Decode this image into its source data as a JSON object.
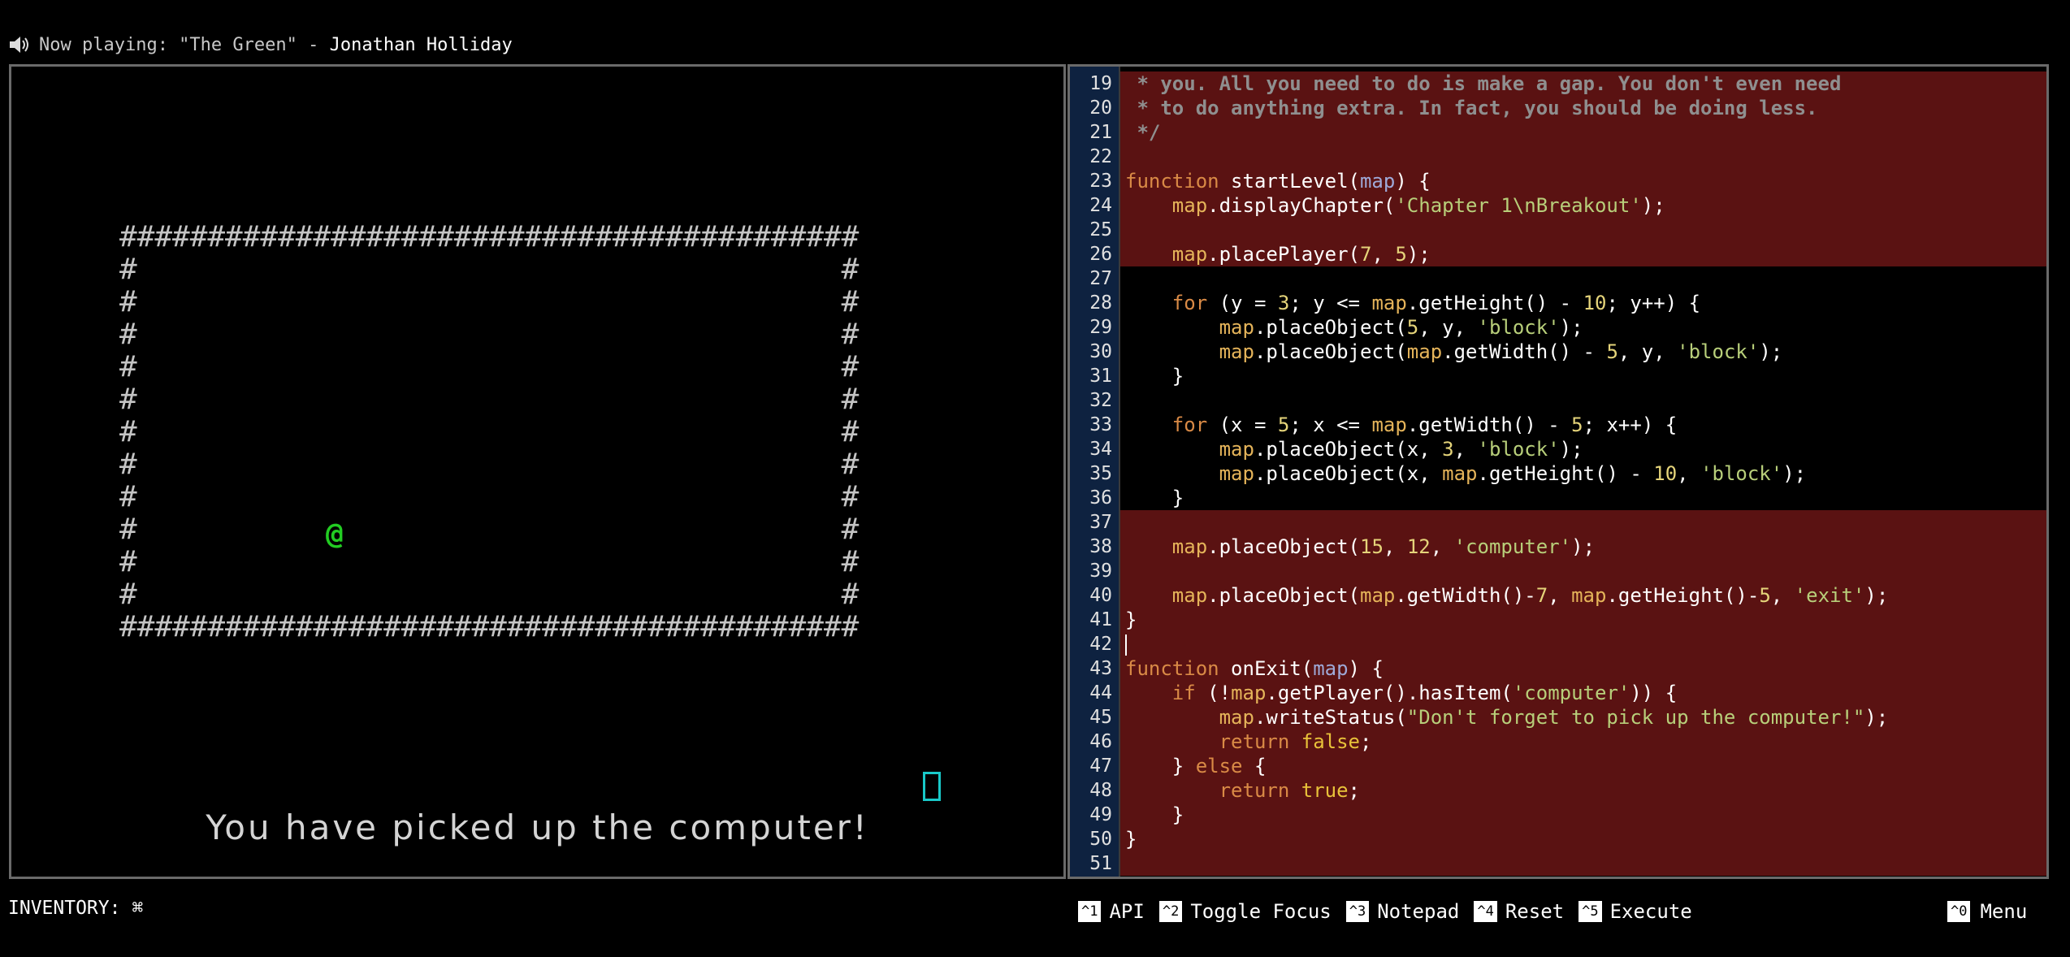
{
  "now_playing": {
    "icon": "speaker-icon",
    "label": "Now playing: \"The Green\" - ",
    "artist": "Jonathan Holliday"
  },
  "game": {
    "map_rows": [
      "##########################################",
      "#                                        #",
      "#                                        #",
      "#                                        #",
      "#                                        #",
      "#                                        #",
      "#                                        #",
      "#                                        #",
      "#                                        #",
      "#                                        #",
      "#                                        #",
      "#                                        #",
      "##########################################"
    ],
    "player_symbol": "@",
    "status": "You have picked up the computer!",
    "colors": {
      "wall": "#c4c4c4",
      "player": "#22cc22",
      "computer": "#19c9c9",
      "locked_code_bg": "#5a1212"
    }
  },
  "editor": {
    "lines": [
      {
        "n": "19",
        "locked": true,
        "tokens": [
          {
            "c": "cm",
            "t": " * you. All you need to do is make a gap. You don't even need"
          }
        ]
      },
      {
        "n": "20",
        "locked": true,
        "tokens": [
          {
            "c": "cm",
            "t": " * to do anything extra. In fact, you should be doing less."
          }
        ]
      },
      {
        "n": "21",
        "locked": true,
        "tokens": [
          {
            "c": "cm",
            "t": " */"
          }
        ]
      },
      {
        "n": "22",
        "locked": true,
        "tokens": []
      },
      {
        "n": "23",
        "locked": true,
        "tokens": [
          {
            "c": "kw",
            "t": "function"
          },
          {
            "c": "fn",
            "t": " startLevel("
          },
          {
            "c": "prm",
            "t": "map"
          },
          {
            "c": "fn",
            "t": ") {"
          }
        ]
      },
      {
        "n": "24",
        "locked": true,
        "tokens": [
          {
            "c": "fn",
            "t": "    "
          },
          {
            "c": "mp",
            "t": "map"
          },
          {
            "c": "fn",
            "t": ".displayChapter("
          },
          {
            "c": "str",
            "t": "'Chapter 1\\nBreakout'"
          },
          {
            "c": "fn",
            "t": ");"
          }
        ]
      },
      {
        "n": "25",
        "locked": true,
        "tokens": []
      },
      {
        "n": "26",
        "locked": true,
        "tokens": [
          {
            "c": "fn",
            "t": "    "
          },
          {
            "c": "mp",
            "t": "map"
          },
          {
            "c": "fn",
            "t": ".placePlayer("
          },
          {
            "c": "num",
            "t": "7"
          },
          {
            "c": "fn",
            "t": ", "
          },
          {
            "c": "num",
            "t": "5"
          },
          {
            "c": "fn",
            "t": ");"
          }
        ]
      },
      {
        "n": "27",
        "locked": false,
        "tokens": []
      },
      {
        "n": "28",
        "locked": false,
        "tokens": [
          {
            "c": "fn",
            "t": "    "
          },
          {
            "c": "kw",
            "t": "for"
          },
          {
            "c": "fn",
            "t": " (y = "
          },
          {
            "c": "num",
            "t": "3"
          },
          {
            "c": "fn",
            "t": "; y <= "
          },
          {
            "c": "mp",
            "t": "map"
          },
          {
            "c": "fn",
            "t": ".getHeight() - "
          },
          {
            "c": "num",
            "t": "10"
          },
          {
            "c": "fn",
            "t": "; y++) {"
          }
        ]
      },
      {
        "n": "29",
        "locked": false,
        "tokens": [
          {
            "c": "fn",
            "t": "        "
          },
          {
            "c": "mp",
            "t": "map"
          },
          {
            "c": "fn",
            "t": ".placeObject("
          },
          {
            "c": "num",
            "t": "5"
          },
          {
            "c": "fn",
            "t": ", y, "
          },
          {
            "c": "str",
            "t": "'block'"
          },
          {
            "c": "fn",
            "t": ");"
          }
        ]
      },
      {
        "n": "30",
        "locked": false,
        "tokens": [
          {
            "c": "fn",
            "t": "        "
          },
          {
            "c": "mp",
            "t": "map"
          },
          {
            "c": "fn",
            "t": ".placeObject("
          },
          {
            "c": "mp",
            "t": "map"
          },
          {
            "c": "fn",
            "t": ".getWidth() - "
          },
          {
            "c": "num",
            "t": "5"
          },
          {
            "c": "fn",
            "t": ", y, "
          },
          {
            "c": "str",
            "t": "'block'"
          },
          {
            "c": "fn",
            "t": ");"
          }
        ]
      },
      {
        "n": "31",
        "locked": false,
        "tokens": [
          {
            "c": "fn",
            "t": "    }"
          }
        ]
      },
      {
        "n": "32",
        "locked": false,
        "tokens": []
      },
      {
        "n": "33",
        "locked": false,
        "tokens": [
          {
            "c": "fn",
            "t": "    "
          },
          {
            "c": "kw",
            "t": "for"
          },
          {
            "c": "fn",
            "t": " (x = "
          },
          {
            "c": "num",
            "t": "5"
          },
          {
            "c": "fn",
            "t": "; x <= "
          },
          {
            "c": "mp",
            "t": "map"
          },
          {
            "c": "fn",
            "t": ".getWidth() - "
          },
          {
            "c": "num",
            "t": "5"
          },
          {
            "c": "fn",
            "t": "; x++) {"
          }
        ]
      },
      {
        "n": "34",
        "locked": false,
        "tokens": [
          {
            "c": "fn",
            "t": "        "
          },
          {
            "c": "mp",
            "t": "map"
          },
          {
            "c": "fn",
            "t": ".placeObject(x, "
          },
          {
            "c": "num",
            "t": "3"
          },
          {
            "c": "fn",
            "t": ", "
          },
          {
            "c": "str",
            "t": "'block'"
          },
          {
            "c": "fn",
            "t": ");"
          }
        ]
      },
      {
        "n": "35",
        "locked": false,
        "tokens": [
          {
            "c": "fn",
            "t": "        "
          },
          {
            "c": "mp",
            "t": "map"
          },
          {
            "c": "fn",
            "t": ".placeObject(x, "
          },
          {
            "c": "mp",
            "t": "map"
          },
          {
            "c": "fn",
            "t": ".getHeight() - "
          },
          {
            "c": "num",
            "t": "10"
          },
          {
            "c": "fn",
            "t": ", "
          },
          {
            "c": "str",
            "t": "'block'"
          },
          {
            "c": "fn",
            "t": ");"
          }
        ]
      },
      {
        "n": "36",
        "locked": false,
        "tokens": [
          {
            "c": "fn",
            "t": "    }"
          }
        ]
      },
      {
        "n": "37",
        "locked": true,
        "tokens": []
      },
      {
        "n": "38",
        "locked": true,
        "tokens": [
          {
            "c": "fn",
            "t": "    "
          },
          {
            "c": "mp",
            "t": "map"
          },
          {
            "c": "fn",
            "t": ".placeObject("
          },
          {
            "c": "num",
            "t": "15"
          },
          {
            "c": "fn",
            "t": ", "
          },
          {
            "c": "num",
            "t": "12"
          },
          {
            "c": "fn",
            "t": ", "
          },
          {
            "c": "str",
            "t": "'computer'"
          },
          {
            "c": "fn",
            "t": ");"
          }
        ]
      },
      {
        "n": "39",
        "locked": true,
        "tokens": []
      },
      {
        "n": "40",
        "locked": true,
        "tokens": [
          {
            "c": "fn",
            "t": "    "
          },
          {
            "c": "mp",
            "t": "map"
          },
          {
            "c": "fn",
            "t": ".placeObject("
          },
          {
            "c": "mp",
            "t": "map"
          },
          {
            "c": "fn",
            "t": ".getWidth()-"
          },
          {
            "c": "num",
            "t": "7"
          },
          {
            "c": "fn",
            "t": ", "
          },
          {
            "c": "mp",
            "t": "map"
          },
          {
            "c": "fn",
            "t": ".getHeight()-"
          },
          {
            "c": "num",
            "t": "5"
          },
          {
            "c": "fn",
            "t": ", "
          },
          {
            "c": "str",
            "t": "'exit'"
          },
          {
            "c": "fn",
            "t": ");"
          }
        ]
      },
      {
        "n": "41",
        "locked": true,
        "tokens": [
          {
            "c": "fn",
            "t": "}"
          }
        ]
      },
      {
        "n": "42",
        "locked": true,
        "caret": true,
        "tokens": []
      },
      {
        "n": "43",
        "locked": true,
        "tokens": [
          {
            "c": "kw",
            "t": "function"
          },
          {
            "c": "fn",
            "t": " onExit("
          },
          {
            "c": "prm",
            "t": "map"
          },
          {
            "c": "fn",
            "t": ") {"
          }
        ]
      },
      {
        "n": "44",
        "locked": true,
        "tokens": [
          {
            "c": "fn",
            "t": "    "
          },
          {
            "c": "kw",
            "t": "if"
          },
          {
            "c": "fn",
            "t": " (!"
          },
          {
            "c": "mp",
            "t": "map"
          },
          {
            "c": "fn",
            "t": ".getPlayer().hasItem("
          },
          {
            "c": "str",
            "t": "'computer'"
          },
          {
            "c": "fn",
            "t": ")) {"
          }
        ]
      },
      {
        "n": "45",
        "locked": true,
        "tokens": [
          {
            "c": "fn",
            "t": "        "
          },
          {
            "c": "mp",
            "t": "map"
          },
          {
            "c": "fn",
            "t": ".writeStatus("
          },
          {
            "c": "str",
            "t": "\"Don't forget to pick up the computer!\""
          },
          {
            "c": "fn",
            "t": ");"
          }
        ]
      },
      {
        "n": "46",
        "locked": true,
        "tokens": [
          {
            "c": "fn",
            "t": "        "
          },
          {
            "c": "kw",
            "t": "return"
          },
          {
            "c": "fn",
            "t": " "
          },
          {
            "c": "bool",
            "t": "false"
          },
          {
            "c": "fn",
            "t": ";"
          }
        ]
      },
      {
        "n": "47",
        "locked": true,
        "tokens": [
          {
            "c": "fn",
            "t": "    } "
          },
          {
            "c": "kw",
            "t": "else"
          },
          {
            "c": "fn",
            "t": " {"
          }
        ]
      },
      {
        "n": "48",
        "locked": true,
        "tokens": [
          {
            "c": "fn",
            "t": "        "
          },
          {
            "c": "kw",
            "t": "return"
          },
          {
            "c": "fn",
            "t": " "
          },
          {
            "c": "bool",
            "t": "true"
          },
          {
            "c": "fn",
            "t": ";"
          }
        ]
      },
      {
        "n": "49",
        "locked": true,
        "tokens": [
          {
            "c": "fn",
            "t": "    }"
          }
        ]
      },
      {
        "n": "50",
        "locked": true,
        "tokens": [
          {
            "c": "fn",
            "t": "}"
          }
        ]
      },
      {
        "n": "51",
        "locked": true,
        "tokens": []
      }
    ]
  },
  "inventory": {
    "label": "INVENTORY:",
    "items": [
      "⌘"
    ]
  },
  "hotkeys": [
    {
      "key": "^1",
      "label": "API",
      "name": "api-button"
    },
    {
      "key": "^2",
      "label": "Toggle Focus",
      "name": "toggle-focus-button"
    },
    {
      "key": "^3",
      "label": "Notepad",
      "name": "notepad-button"
    },
    {
      "key": "^4",
      "label": "Reset",
      "name": "reset-button"
    },
    {
      "key": "^5",
      "label": "Execute",
      "name": "execute-button"
    }
  ],
  "menu": {
    "key": "^0",
    "label": "Menu"
  }
}
